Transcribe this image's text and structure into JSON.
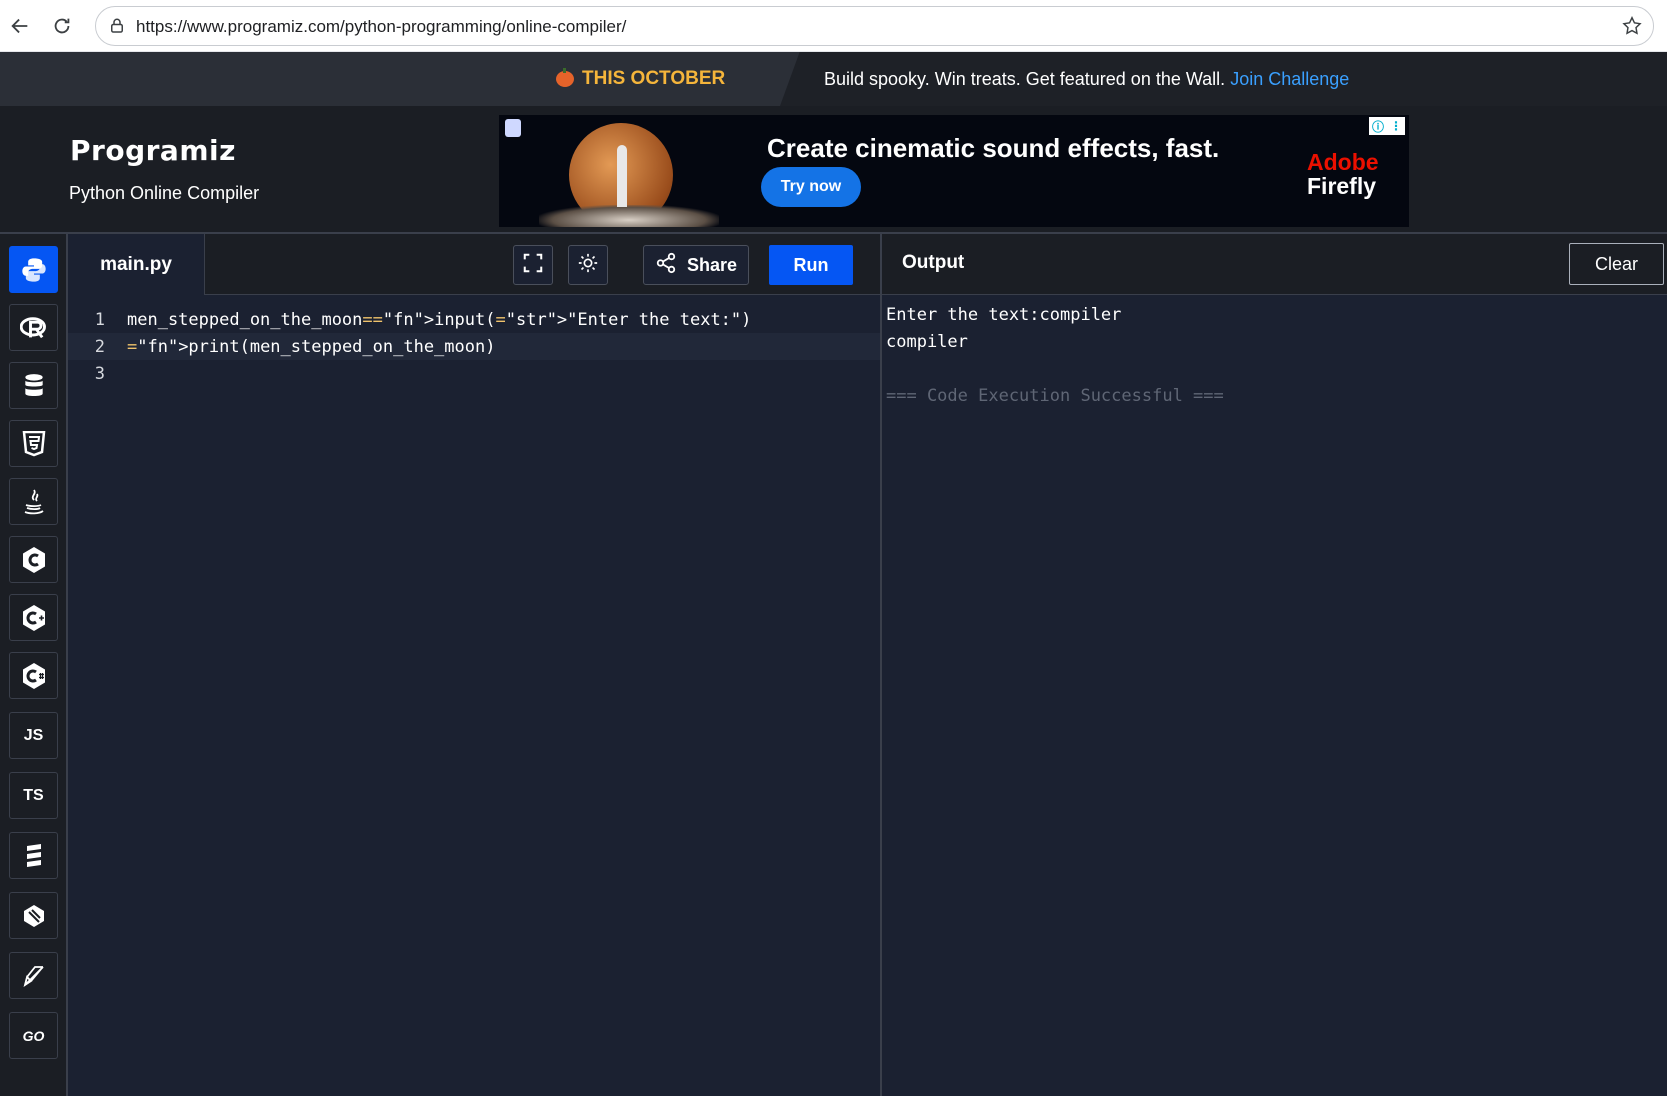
{
  "browser": {
    "url": "https://www.programiz.com/python-programming/online-compiler/"
  },
  "promo": {
    "left_text": "THIS OCTOBER",
    "right_text": "Build spooky. Win treats. Get featured on the Wall.",
    "link_text": "Join Challenge"
  },
  "header": {
    "logo": "Programiz",
    "subtitle": "Python Online Compiler"
  },
  "ad": {
    "headline": "Create cinematic sound effects, fast.",
    "cta": "Try now",
    "brand_line1": "Adobe",
    "brand_line2": "Firefly"
  },
  "sidebar": {
    "languages": [
      {
        "name": "Python",
        "icon": "python-icon",
        "active": true
      },
      {
        "name": "R",
        "icon": "r-icon"
      },
      {
        "name": "SQL",
        "icon": "database-icon"
      },
      {
        "name": "HTML",
        "icon": "html5-icon"
      },
      {
        "name": "Java",
        "icon": "java-icon"
      },
      {
        "name": "C",
        "icon": "c-icon"
      },
      {
        "name": "C++",
        "icon": "cpp-icon"
      },
      {
        "name": "C#",
        "icon": "csharp-icon"
      },
      {
        "name": "JS",
        "label": "JS",
        "icon": "js-icon"
      },
      {
        "name": "TS",
        "label": "TS",
        "icon": "ts-icon"
      },
      {
        "name": "Go stack",
        "icon": "stack-icon"
      },
      {
        "name": "Swift",
        "icon": "swift-icon"
      },
      {
        "name": "Rust",
        "icon": "rust-icon"
      },
      {
        "name": "Go",
        "label": "GO",
        "icon": "go-icon"
      }
    ]
  },
  "editor": {
    "tab_label": "main.py",
    "share_label": "Share",
    "run_label": "Run",
    "lines": [
      {
        "num": "1",
        "code": "men_stepped_on_the_moon=input(\"Enter the text:\")"
      },
      {
        "num": "2",
        "code": "print(men_stepped_on_the_moon)"
      },
      {
        "num": "3",
        "code": ""
      }
    ]
  },
  "output": {
    "title": "Output",
    "clear_label": "Clear",
    "lines": [
      "Enter the text:compiler",
      "compiler",
      "",
      "=== Code Execution Successful ==="
    ]
  },
  "colors": {
    "accent": "#0556f3",
    "promo_highlight": "#f5b53b",
    "link": "#3aa0ff",
    "keyword": "#f0c36c",
    "string": "#a9b1a0",
    "background": "#1b2131"
  }
}
